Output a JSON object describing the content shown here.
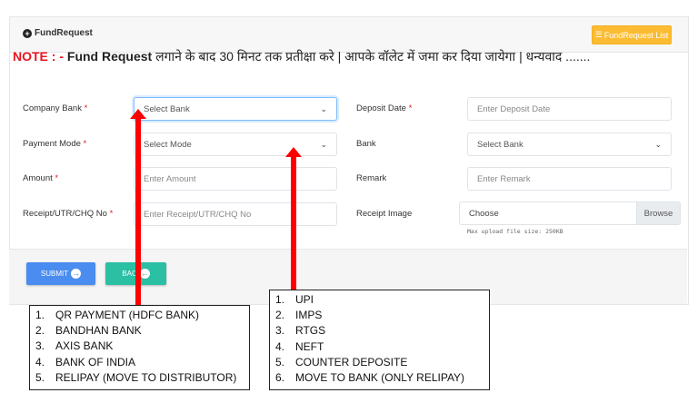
{
  "header": {
    "title": "FundRequest",
    "list_button": "FundRequest List"
  },
  "note": {
    "prefix": "NOTE : -",
    "bold": "Fund Request",
    "text": " लगाने के बाद  30 मिनट तक प्रतीक्षा करे | आपके वॉलेट में जमा कर दिया जायेगा | धन्यवाद ......."
  },
  "form": {
    "company_bank": {
      "label": "Company Bank",
      "required": "*",
      "value": "Select Bank"
    },
    "deposit_date": {
      "label": "Deposit Date",
      "required": "*",
      "placeholder": "Enter Deposit Date"
    },
    "payment_mode": {
      "label": "Payment Mode",
      "required": "*",
      "value": "Select Mode"
    },
    "bank": {
      "label": "Bank",
      "value": "Select Bank"
    },
    "amount": {
      "label": "Amount",
      "required": "*",
      "placeholder": "Enter Amount"
    },
    "remark": {
      "label": "Remark",
      "placeholder": "Enter Remark"
    },
    "receipt_no": {
      "label": "Receipt/UTR/CHQ No",
      "required": "*",
      "placeholder": "Enter Receipt/UTR/CHQ No"
    },
    "receipt_image": {
      "label": "Receipt Image",
      "value": "Choose",
      "browse": "Browse",
      "hint": "Max upload file size: 250KB"
    }
  },
  "footer": {
    "submit": "SUBMIT",
    "back": "BAC"
  },
  "annotations": {
    "company_banks": [
      {
        "n": "1.",
        "t": "QR PAYMENT (HDFC BANK)"
      },
      {
        "n": "2.",
        "t": "BANDHAN BANK"
      },
      {
        "n": "3.",
        "t": "AXIS BANK"
      },
      {
        "n": "4.",
        "t": "BANK OF INDIA"
      },
      {
        "n": "5.",
        "t": "RELIPAY (MOVE TO DISTRIBUTOR)"
      }
    ],
    "payment_modes": [
      {
        "n": "1.",
        "t": "UPI"
      },
      {
        "n": "2.",
        "t": "IMPS"
      },
      {
        "n": "3.",
        "t": "RTGS"
      },
      {
        "n": "4.",
        "t": "NEFT"
      },
      {
        "n": "5.",
        "t": "COUNTER DEPOSITE"
      },
      {
        "n": "6.",
        "t": "MOVE TO BANK (ONLY RELIPAY)"
      }
    ]
  }
}
